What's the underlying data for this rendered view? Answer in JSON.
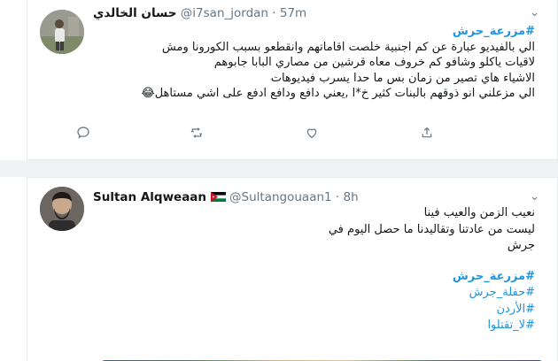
{
  "tweets": [
    {
      "display_name": "حسان الخالدي",
      "handle": "@i7san_jordan",
      "time": "57m",
      "lines": [
        {
          "text": "#مزرعة_حرش",
          "kind": "hashtag_bold"
        },
        {
          "text": "الي بالفيديو عبارة عن كم اجنبية خلصت اقاماتهم وانقطعو بسبب الكورونا ومش",
          "kind": "text"
        },
        {
          "text": "لاقيات ياكلو وشافو كم خروف معاه قرشين من مصاري البابا جابوهم",
          "kind": "text"
        },
        {
          "text": "الاشياء هاي تصير من زمان بس ما حدا يسرب فيديوهات",
          "kind": "text"
        },
        {
          "text": "الي مزعلني انو ذوقهم بالبنات كثير خ*ا ,يعني دافع ودافع ادفع على اشي مستاهل😂",
          "kind": "text"
        }
      ]
    },
    {
      "display_name": "Sultan Alqweaan",
      "handle": "@Sultangouaan1",
      "time": "8h",
      "lines": [
        {
          "text": "نعيب الزمن والعيب فينا",
          "kind": "text"
        },
        {
          "text": "ليست من عادتنا وتقاليدنا ما حصل اليوم في",
          "kind": "text"
        },
        {
          "text": "جرش",
          "kind": "text"
        },
        {
          "text": "",
          "kind": "gap"
        },
        {
          "text": "#مزرعة_حرش",
          "kind": "hashtag_bold"
        },
        {
          "text": "#حفلة_جرش",
          "kind": "hashtag"
        },
        {
          "text": "#الأردن",
          "kind": "hashtag"
        },
        {
          "text": "#لا_تقتلوا",
          "kind": "hashtag"
        }
      ]
    }
  ],
  "icons": {
    "reply": "reply-icon",
    "retweet": "retweet-icon",
    "like": "heart-icon",
    "share": "share-icon",
    "caret": "chevron-down-icon",
    "flag": "jordan-flag-icon"
  },
  "colors": {
    "link": "#1b95e0",
    "meta": "#657786",
    "text": "#14171a",
    "divider": "#e6ecf0"
  }
}
